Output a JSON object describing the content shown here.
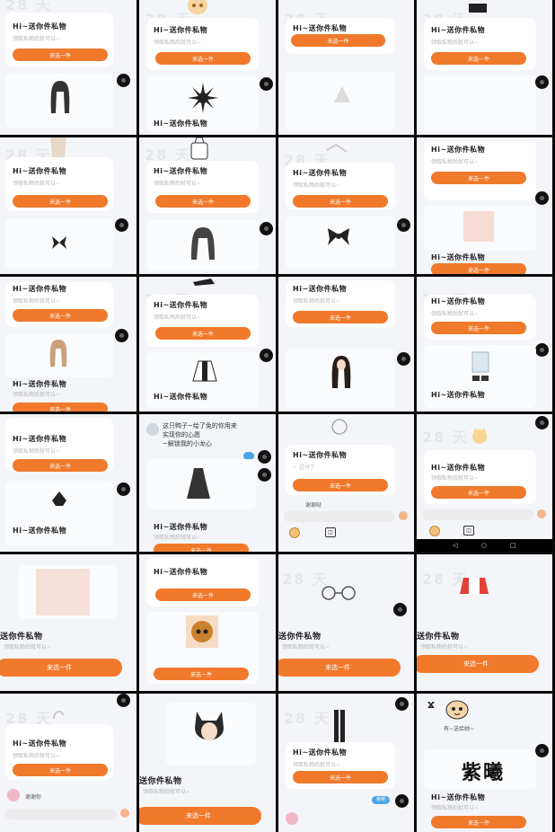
{
  "common": {
    "title": "Hi~送你件私物",
    "title_big": "送你件私物",
    "subtitle": "领取私物后就可以~",
    "button": "来选一件",
    "watermark": "28 天"
  },
  "tile_r4c1": {
    "message_lines": [
      "这只鸭子~给了免的你用来",
      "实现你的心愿",
      "~解锁我的小龙心"
    ],
    "caption": "看看"
  },
  "tile_r4c3": {
    "text": "~ 过分了",
    "small": "谢谢哒"
  },
  "tile_r5c1": {
    "top_text": "Hi~送你件私物"
  },
  "tile_r5c3": {
    "pill": "谢谢"
  },
  "tile_r5c0": {
    "chat_name": "谢谢你"
  },
  "tile_r5c3_label": {
    "text": "紫曦",
    "note": "有~送给她~"
  },
  "nav": {
    "back": "◁",
    "home": "○",
    "recent": "□"
  }
}
